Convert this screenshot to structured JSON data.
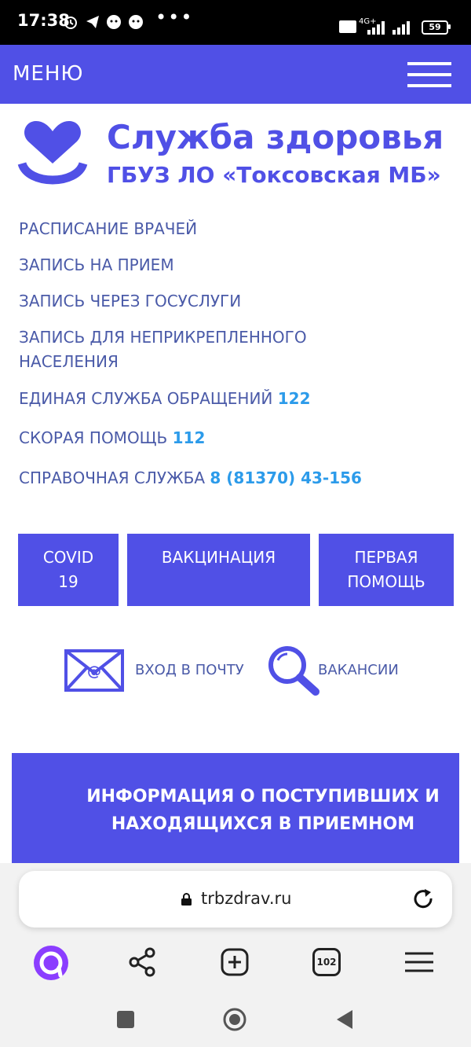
{
  "status_bar": {
    "time": "17:38",
    "more": "•••",
    "network": "4G+",
    "battery": "59"
  },
  "header": {
    "menu_label": "МЕНЮ"
  },
  "brand": {
    "title": "Служба здоровья",
    "subtitle": "ГБУЗ ЛО «Токсовская МБ»",
    "color": "#5050e6"
  },
  "nav_links": [
    {
      "label": "РАСПИСАНИЕ ВРАЧЕЙ",
      "number": ""
    },
    {
      "label": "ЗАПИСЬ НА ПРИЕМ",
      "number": ""
    },
    {
      "label": "ЗАПИСЬ ЧЕРЕЗ ГОСУСЛУГИ",
      "number": ""
    },
    {
      "label": "ЗАПИСЬ ДЛЯ НЕПРИКРЕПЛЕННОГО НАСЕЛЕНИЯ",
      "number": ""
    },
    {
      "label": "ЕДИНАЯ СЛУЖБА ОБРАЩЕНИЙ ",
      "number": "122"
    },
    {
      "label": "СКОРАЯ ПОМОЩЬ ",
      "number": "112"
    },
    {
      "label": "СПРАВОЧНАЯ СЛУЖБА ",
      "number": "8 (81370) 43-156"
    }
  ],
  "buttons": {
    "covid": "COVID 19",
    "vaccination": "ВАКЦИНАЦИЯ",
    "first_aid": "ПЕРВАЯ ПОМОЩЬ"
  },
  "icon_links": {
    "mail": "ВХОД В ПОЧТУ",
    "vacancies": "ВАКАНСИИ"
  },
  "info_banner": {
    "text": "ИНФОРМАЦИЯ О ПОСТУПИВШИХ И НАХОДЯЩИХСЯ В ПРИЕМНОМ"
  },
  "browser": {
    "url": "trbzdrav.ru",
    "tabs_count": "102"
  },
  "colors": {
    "accent": "#5050e6",
    "link": "#4a5aa8",
    "highlight": "#2c9bea",
    "alice": "#8b3dff"
  }
}
